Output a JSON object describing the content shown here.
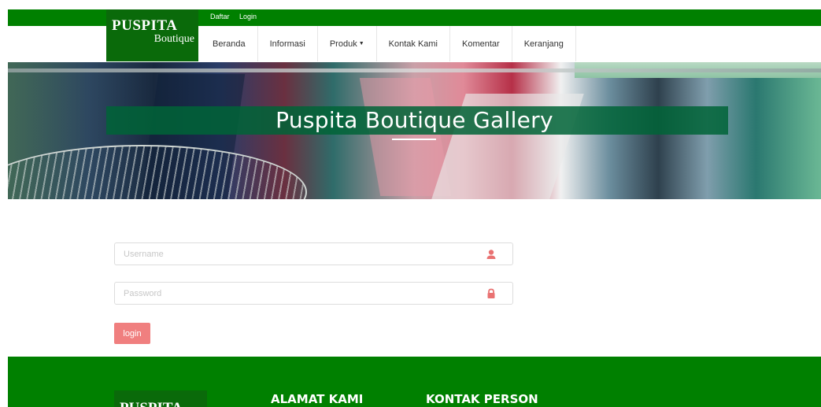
{
  "header": {
    "top_links": [
      "Daftar",
      "Login"
    ],
    "logo_line1": "PUSPITA",
    "logo_line2": "Boutique",
    "nav": [
      {
        "label": "Beranda"
      },
      {
        "label": "Informasi"
      },
      {
        "label": "Produk",
        "has_dropdown": true
      },
      {
        "label": "Kontak Kami"
      },
      {
        "label": "Komentar"
      },
      {
        "label": "Keranjang"
      }
    ],
    "colors": {
      "brand_green": "#008000",
      "logo_green": "#0a6a0a"
    }
  },
  "hero": {
    "title": "Puspita Boutique Gallery"
  },
  "login_form": {
    "username_placeholder": "Username",
    "username_icon": "user-icon",
    "password_placeholder": "Password",
    "password_icon": "lock-icon",
    "submit_label": "login",
    "accent_color": "#f07f7f"
  },
  "footer": {
    "logo_text": "PUSPITA",
    "col1_heading": "ALAMAT KAMI",
    "col2_heading": "KONTAK PERSON"
  }
}
